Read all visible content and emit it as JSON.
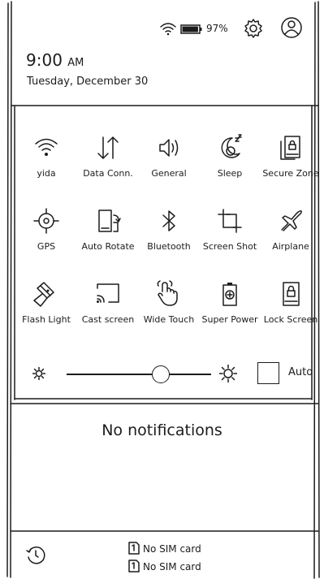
{
  "status_bar": {
    "battery_text": "97%",
    "battery_level": 0.97,
    "icons": [
      "wifi-icon",
      "battery-icon",
      "gear-icon",
      "user-icon"
    ]
  },
  "clock": {
    "time": "9:00",
    "ampm": "AM",
    "date": "Tuesday, December 30"
  },
  "quick_settings": [
    {
      "label": "yida",
      "icon": "wifi-icon"
    },
    {
      "label": "Data Conn.",
      "icon": "data-arrows-icon"
    },
    {
      "label": "General",
      "icon": "speaker-icon"
    },
    {
      "label": "Sleep",
      "icon": "moon-icon"
    },
    {
      "label": "Secure Zone",
      "icon": "secure-zone-icon"
    },
    {
      "label": "GPS",
      "icon": "gps-icon"
    },
    {
      "label": "Auto Rotate",
      "icon": "rotate-icon"
    },
    {
      "label": "Bluetooth",
      "icon": "bluetooth-icon"
    },
    {
      "label": "Screen Shot",
      "icon": "crop-icon"
    },
    {
      "label": "Airplane",
      "icon": "airplane-icon"
    },
    {
      "label": "Flash Light",
      "icon": "flashlight-icon"
    },
    {
      "label": "Cast screen",
      "icon": "cast-icon"
    },
    {
      "label": "Wide Touch",
      "icon": "touch-icon"
    },
    {
      "label": "Super Power",
      "icon": "battery-plus-icon"
    },
    {
      "label": "Lock Screen",
      "icon": "lock-phone-icon"
    }
  ],
  "brightness": {
    "auto_label": "Auto",
    "level": 0.65,
    "auto_checked": false
  },
  "notifications": {
    "empty_text": "No notifications"
  },
  "sim": {
    "slot1": "No SIM card",
    "slot2": "No SIM card"
  }
}
